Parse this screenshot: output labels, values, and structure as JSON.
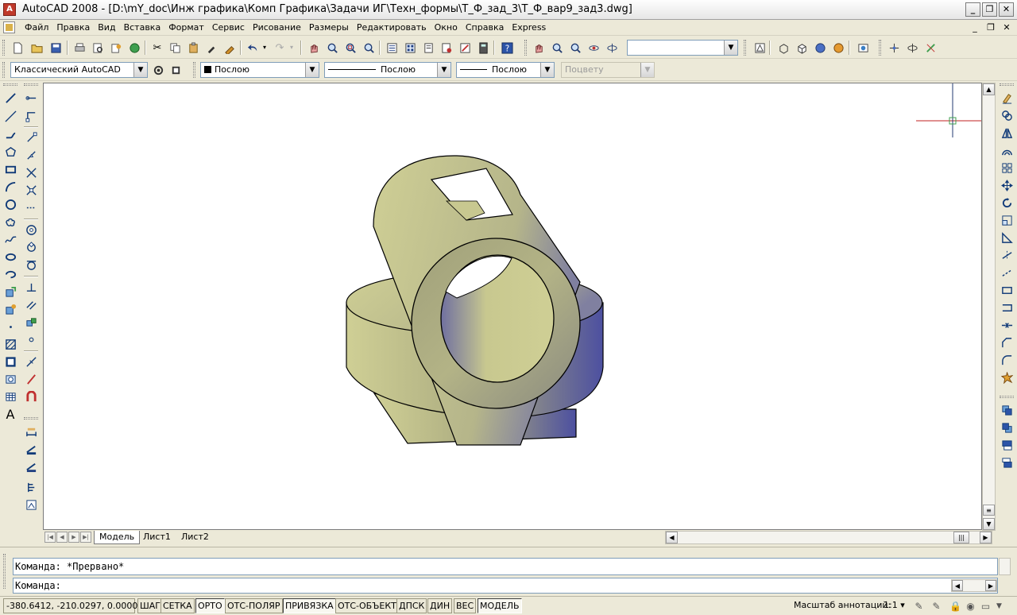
{
  "window": {
    "title": "AutoCAD 2008 - [D:\\mY_doc\\Инж графика\\Комп Графика\\Задачи ИГ\\Техн_формы\\Т_Ф_зад_3\\Т_Ф_вар9_зад3.dwg]",
    "minimize": "_",
    "maximize": "❐",
    "close": "✕"
  },
  "menu": {
    "items": [
      "Файл",
      "Правка",
      "Вид",
      "Вставка",
      "Формат",
      "Сервис",
      "Рисование",
      "Размеры",
      "Редактировать",
      "Окно",
      "Справка",
      "Express"
    ],
    "mdi_minimize": "_",
    "mdi_restore": "❐",
    "mdi_close": "✕"
  },
  "toolbar2": {
    "workspace": "Классический AutoCAD",
    "color": "Послою",
    "linetype": "Послою",
    "lineweight": "Послою",
    "plotstyle": "Поцвету"
  },
  "tabs": {
    "model": "Модель",
    "sheet1": "Лист1",
    "sheet2": "Лист2"
  },
  "command": {
    "history": "Команда: *Прервано*",
    "prompt": "Команда:"
  },
  "status": {
    "coords": "-380.6412, -210.0297, 0.0000",
    "buttons": [
      {
        "label": "ШАГ",
        "on": false
      },
      {
        "label": "СЕТКА",
        "on": false
      },
      {
        "label": "ОРТО",
        "on": true
      },
      {
        "label": "ОТС-ПОЛЯР",
        "on": false
      },
      {
        "label": "ПРИВЯЗКА",
        "on": true
      },
      {
        "label": "ОТС-ОБЪЕКТ",
        "on": false
      },
      {
        "label": "ДПСК",
        "on": false
      },
      {
        "label": "ДИН",
        "on": false
      },
      {
        "label": "ВЕС",
        "on": false
      },
      {
        "label": "МОДЕЛЬ",
        "on": true
      }
    ],
    "annotation_scale_label": "Масштаб аннотаций:",
    "annotation_scale_value": "1:1 ▾"
  },
  "model_colors": {
    "light": "#cfcf95",
    "mid": "#a8a87e",
    "dark": "#4d50a0"
  }
}
